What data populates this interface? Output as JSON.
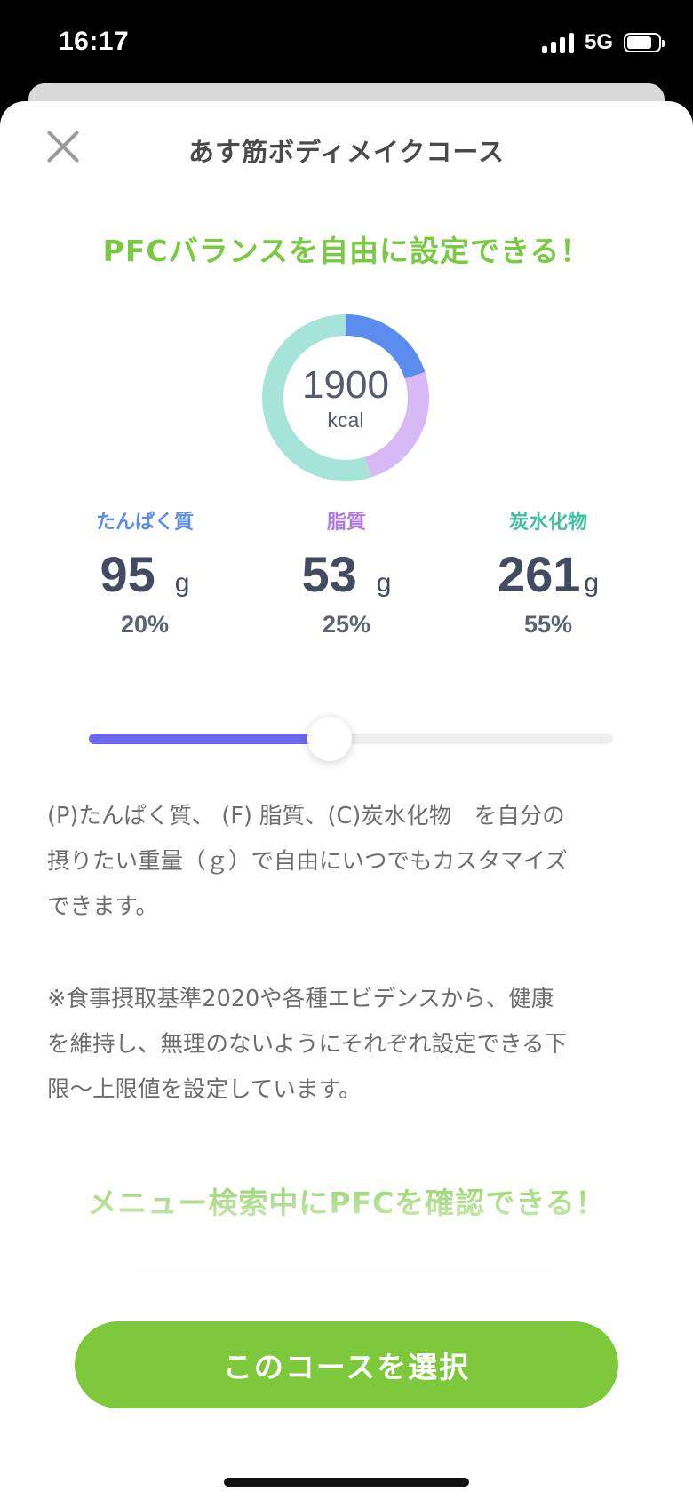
{
  "status_bar": {
    "time": "16:17",
    "network": "5G",
    "battery_level": 0.8
  },
  "header": {
    "close_icon": "close-icon",
    "title": "あす筋ボディメイクコース"
  },
  "pfc_section": {
    "headline": "PFCバランスを自由に設定できる！",
    "calories": {
      "value": "1900",
      "unit": "kcal"
    },
    "macros": [
      {
        "key": "protein",
        "label": "たんぱく質",
        "grams": "95",
        "unit": "g",
        "percent": "20%",
        "share": 0.2,
        "color": "#5b8def"
      },
      {
        "key": "fat",
        "label": "脂質",
        "grams": "53",
        "unit": "g",
        "percent": "25%",
        "share": 0.25,
        "color": "#d6b9f5"
      },
      {
        "key": "carbs",
        "label": "炭水化物",
        "grams": "261",
        "unit": "g",
        "percent": "55%",
        "share": 0.55,
        "color": "#a6e3d9"
      }
    ],
    "label_colors": {
      "protein": "#5b8def",
      "fat": "#b07be3",
      "carbs": "#3fbf9f"
    },
    "slider": {
      "value": 0.46,
      "fill_color": "#6b67ee"
    },
    "description_1": " (P)たんぱく質、 (F) 脂質、(C)炭水化物　を自分の\n摂りたい重量（ｇ）で自由にいつでもカスタマイズ\nできます。",
    "description_2": "※食事摂取基準2020や各種エビデンスから、健康\nを維持し、無理のないようにそれぞれ設定できる下\n限〜上限値を設定しています。"
  },
  "menu_section": {
    "headline": "メニュー検索中にPFCを確認できる！"
  },
  "footer": {
    "select_button": "このコースを選択"
  },
  "colors": {
    "accent_green": "#7ac943",
    "button_green": "#7dc93b"
  }
}
